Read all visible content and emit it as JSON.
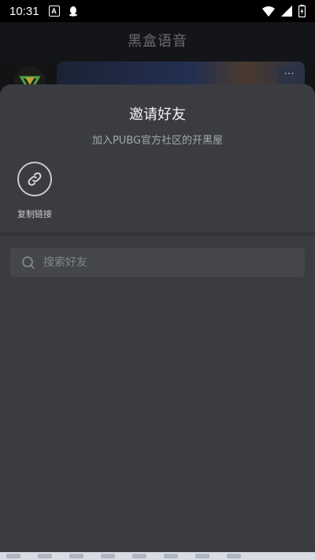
{
  "status_bar": {
    "time": "10:31",
    "left_icons": [
      "a-badge-icon",
      "qq-penguin-icon"
    ],
    "right_icons": [
      "wifi-icon",
      "signal-icon",
      "battery-charging-icon"
    ]
  },
  "background_app": {
    "title": "黑盒语音",
    "more_icon": "more-dots-icon"
  },
  "invite_sheet": {
    "title": "邀请好友",
    "subtitle": "加入PUBG官方社区的开黑屋",
    "share_options": [
      {
        "label": "复制链接",
        "icon": "link-icon"
      }
    ],
    "search": {
      "placeholder": "搜索好友",
      "value": ""
    }
  },
  "colors": {
    "sheet_background": "#3a3c41",
    "search_background": "#44464b",
    "app_background": "#0f1012"
  }
}
